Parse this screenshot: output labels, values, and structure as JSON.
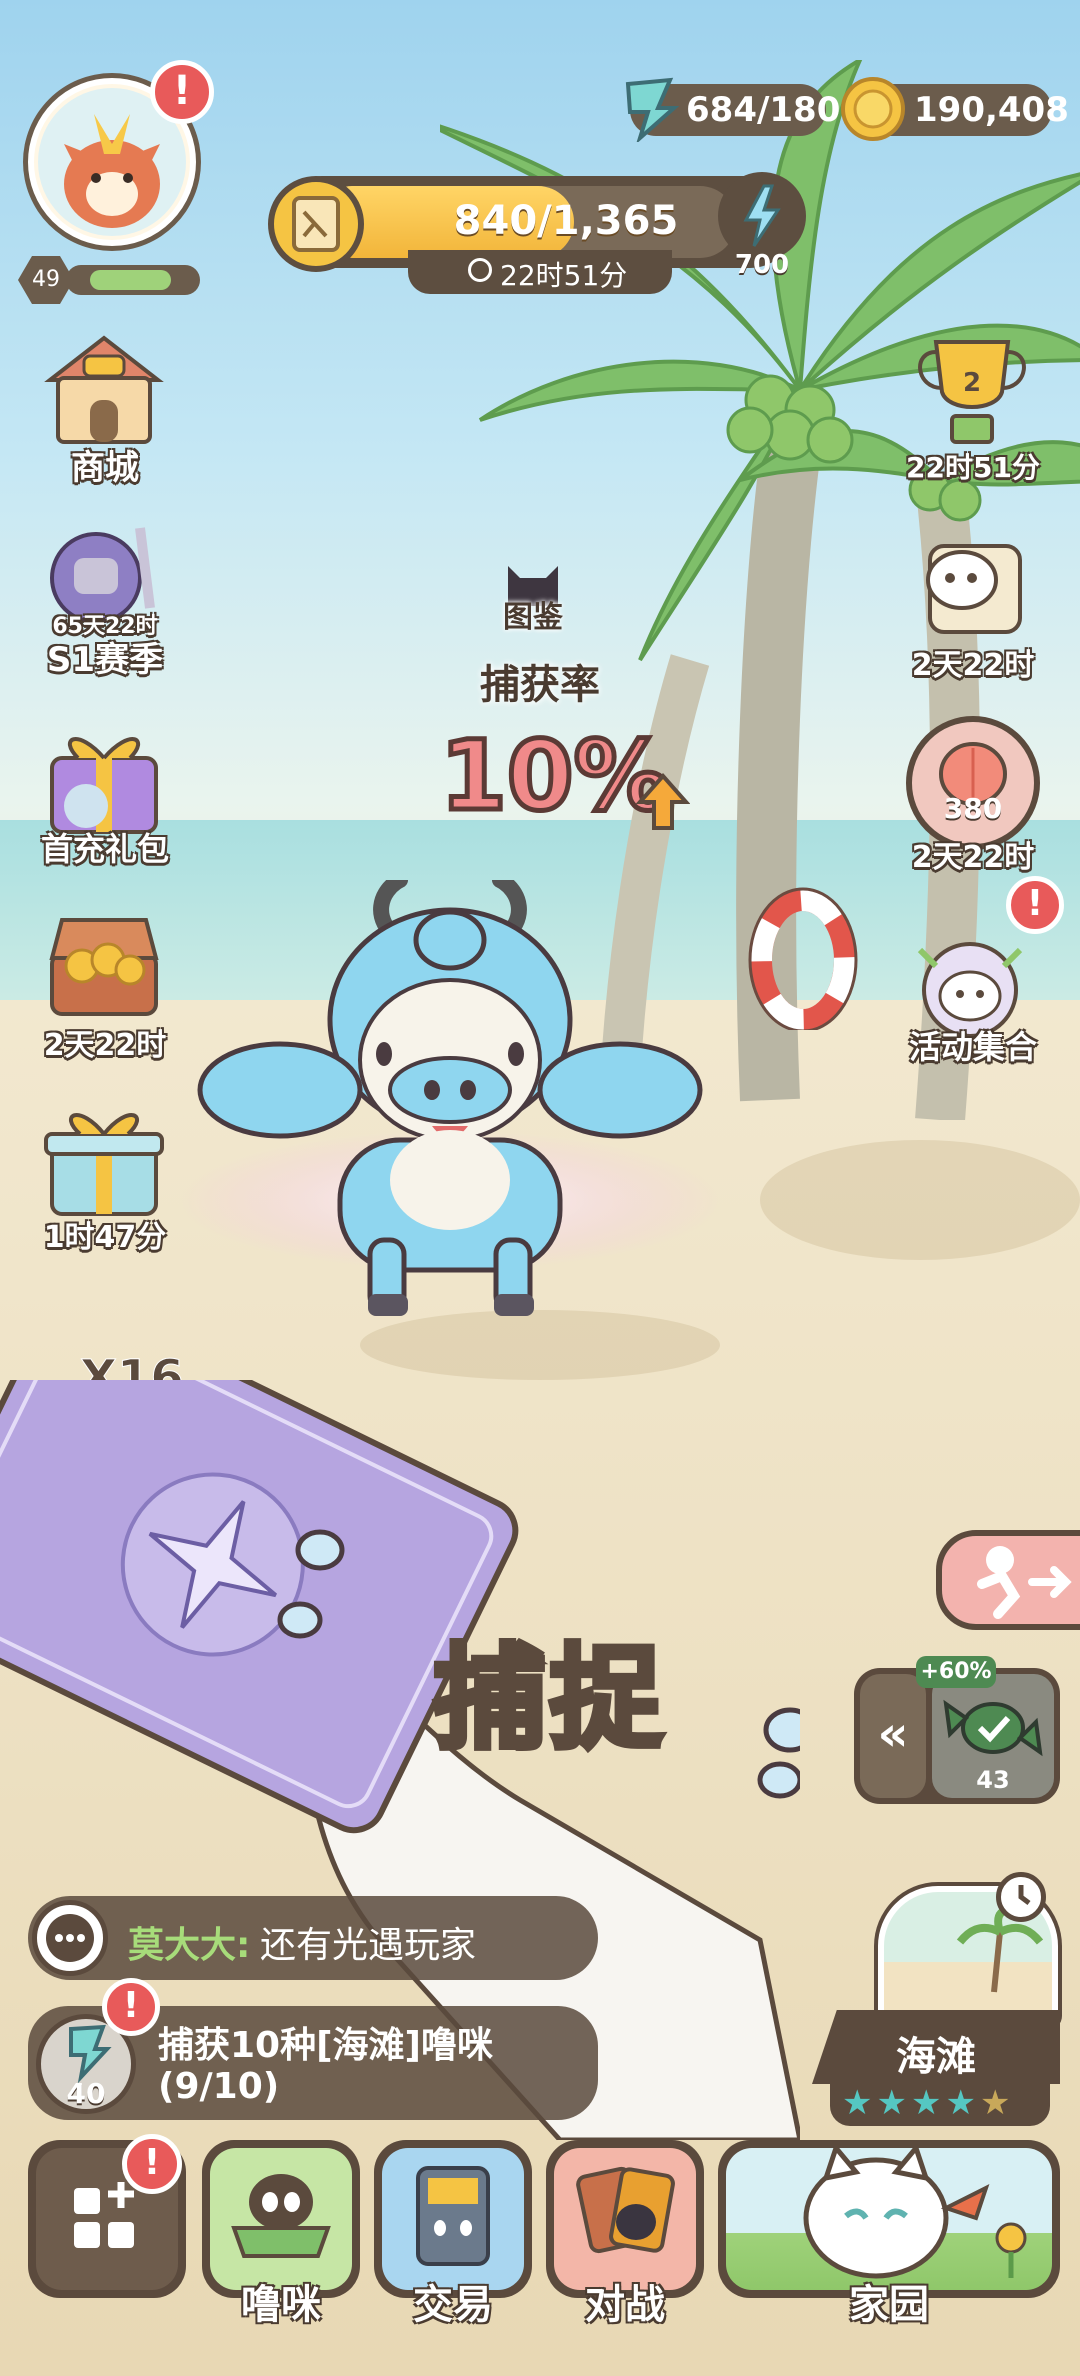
{
  "player": {
    "level": "49",
    "level_progress": 0.78
  },
  "resources": {
    "energy": "684/180",
    "coins": "190,408"
  },
  "exp_bar": {
    "value": "840/1,365",
    "progress": 0.615,
    "timer": "22时51分",
    "bolt_value": "700"
  },
  "left_menu": {
    "shop": "商城",
    "season_timer": "65天22时",
    "season": "S1赛季",
    "first_charge": "首充礼包",
    "chest_timer": "2天22时",
    "gift_timer": "1时47分"
  },
  "right_menu": {
    "trophy_count": "2",
    "trophy_timer": "22时51分",
    "scroll_timer": "2天22时",
    "peach_count": "380",
    "peach_timer": "2天22时",
    "events": "活动集合"
  },
  "capture": {
    "dex_label": "图鉴",
    "rate_label": "捕获率",
    "rate_value": "10%",
    "card_count": "X16",
    "capture_button": "捕捉"
  },
  "bait": {
    "bonus": "+60%",
    "count": "43"
  },
  "chat": {
    "name": "莫大大:",
    "message": "还有光遇玩家"
  },
  "quest": {
    "energy": "40",
    "line1": "捕获10种[海滩]噜咪",
    "line2": "(9/10)"
  },
  "location": {
    "name": "海滩",
    "stars_filled": 4,
    "stars_total": 5
  },
  "nav": {
    "pets": "噜咪",
    "trade": "交易",
    "battle": "对战",
    "home": "家园"
  },
  "alert_mark": "!",
  "colors": {
    "accent_red": "#e85a5a",
    "panel_brown": "#5b4a3d",
    "teal": "#55c7c2",
    "gold": "#f5c443"
  }
}
